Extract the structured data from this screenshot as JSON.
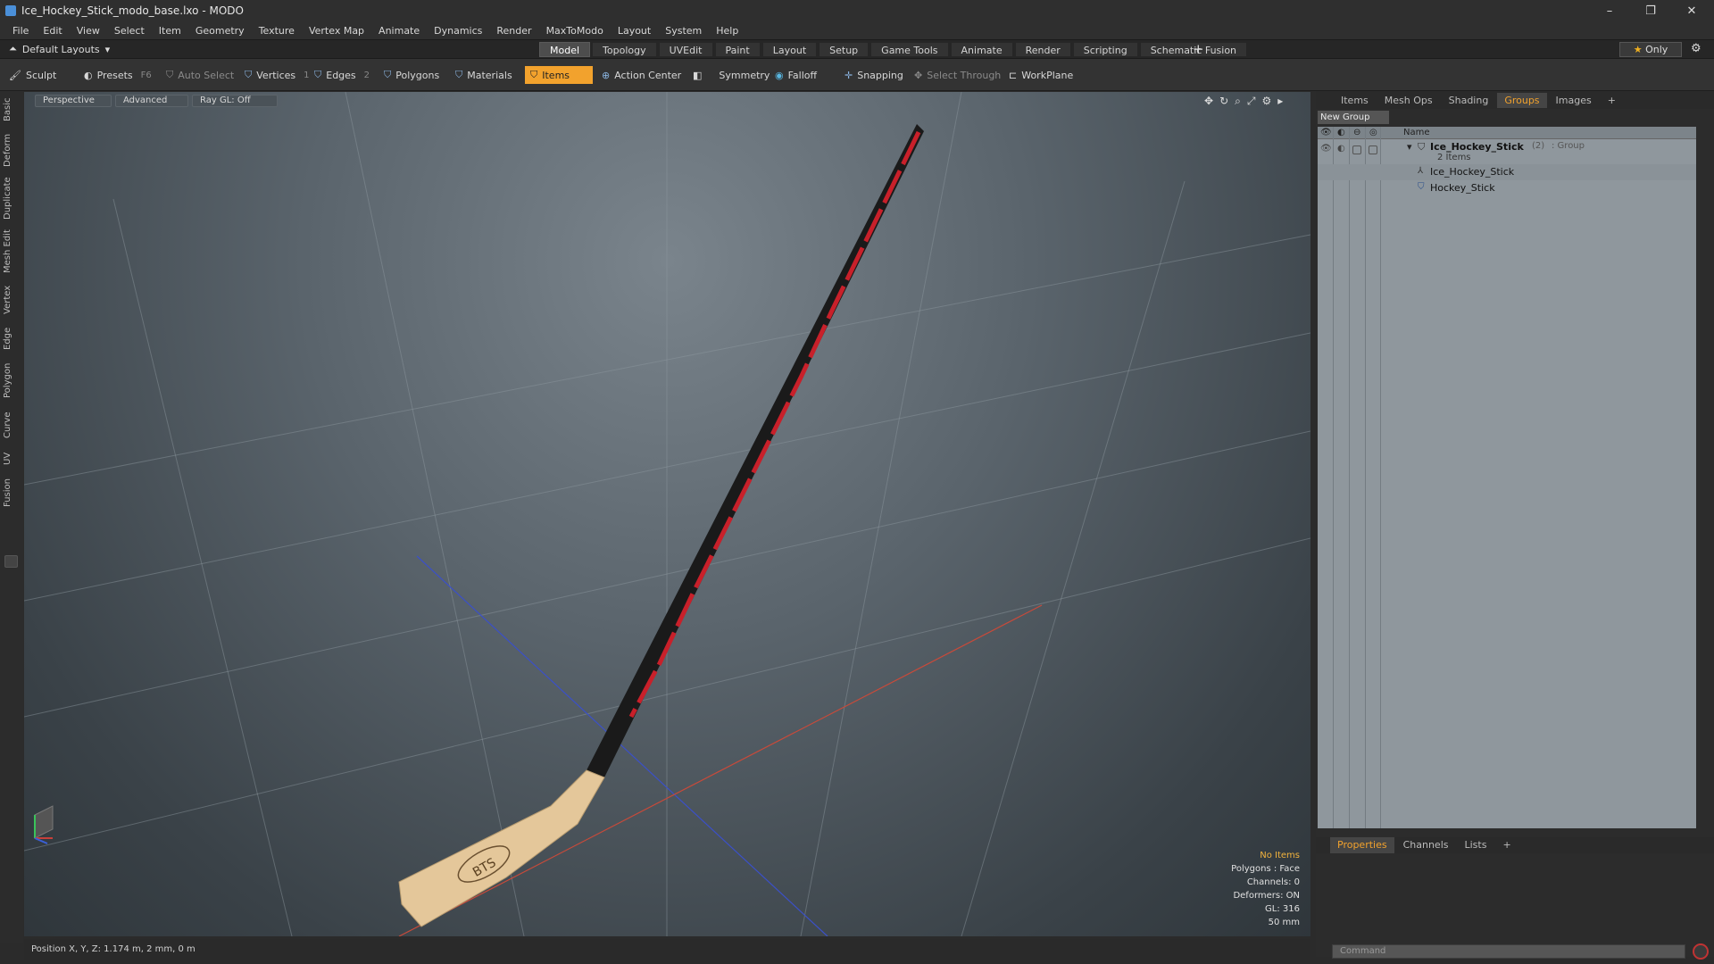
{
  "window": {
    "title": "Ice_Hockey_Stick_modo_base.lxo - MODO",
    "min": "–",
    "max": "❐",
    "close": "✕"
  },
  "menu": [
    "File",
    "Edit",
    "View",
    "Select",
    "Item",
    "Geometry",
    "Texture",
    "Vertex Map",
    "Animate",
    "Dynamics",
    "Render",
    "MaxToModo",
    "Layout",
    "System",
    "Help"
  ],
  "layouts_label": "Default Layouts",
  "mode_tabs": [
    "Model",
    "Topology",
    "UVEdit",
    "Paint",
    "Layout",
    "Setup",
    "Game Tools",
    "Animate",
    "Render",
    "Scripting",
    "Schematic Fusion"
  ],
  "active_mode_tab": "Model",
  "only_label": "Only",
  "toolbar": {
    "sculpt": "Sculpt",
    "presets": "Presets",
    "presets_key": "F6",
    "auto_select": "Auto Select",
    "vertices": "Vertices",
    "vertices_key": "1",
    "edges": "Edges",
    "edges_key": "2",
    "polygons": "Polygons",
    "materials": "Materials",
    "items": "Items",
    "action_center": "Action Center",
    "symmetry": "Symmetry",
    "falloff": "Falloff",
    "snapping": "Snapping",
    "select_through": "Select Through",
    "workplane": "WorkPlane"
  },
  "left_tabs": [
    "Basic",
    "Deform",
    "Duplicate",
    "Mesh Edit",
    "Vertex",
    "Edge",
    "Polygon",
    "Curve",
    "UV",
    "Fusion"
  ],
  "viewport": {
    "view": "Perspective",
    "shading": "Advanced",
    "raygl": "Ray GL: Off",
    "hud": {
      "no_items": "No Items",
      "polygons": "Polygons : Face",
      "channels": "Channels: 0",
      "deformers": "Deformers: ON",
      "gl": "GL: 316",
      "scale": "50 mm"
    },
    "logo_text": "BTS"
  },
  "status": "Position X, Y, Z:   1.174 m, 2 mm, 0 m",
  "right_panel": {
    "tabs": [
      "Items",
      "Mesh Ops",
      "Shading",
      "Groups",
      "Images"
    ],
    "active_tab": "Groups",
    "new_group": "New Group",
    "name_header": "Name",
    "group_name": "Ice_Hockey_Stick",
    "group_count": "(2)",
    "group_type": ": Group",
    "group_items": "2 Items",
    "children": [
      "Ice_Hockey_Stick",
      "Hockey_Stick"
    ]
  },
  "bottom_tabs": [
    "Properties",
    "Channels",
    "Lists"
  ],
  "active_bottom_tab": "Properties",
  "command_placeholder": "Command",
  "colors": {
    "accent": "#f2a22d",
    "stick_red": "#c8202a",
    "blade": "#e4c79a"
  }
}
